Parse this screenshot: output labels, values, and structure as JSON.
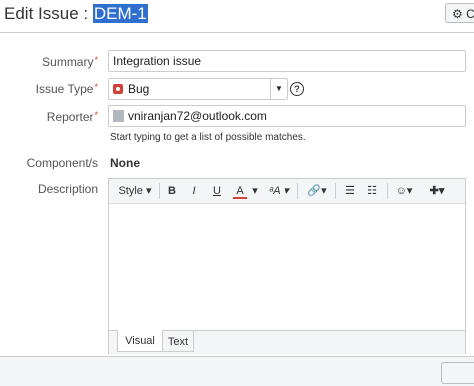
{
  "dialog": {
    "title_prefix": "Edit Issue : ",
    "issue_key": "DEM-1",
    "configure_label": "C"
  },
  "form": {
    "summary": {
      "label": "Summary",
      "value": "Integration issue"
    },
    "issue_type": {
      "label": "Issue Type",
      "value": "Bug"
    },
    "reporter": {
      "label": "Reporter",
      "value": "vniranjan72@outlook.com",
      "hint": "Start typing to get a list of possible matches."
    },
    "components": {
      "label": "Component/s",
      "value": "None"
    },
    "description": {
      "label": "Description"
    }
  },
  "editor": {
    "toolbar": {
      "style": "Style",
      "bold": "B",
      "italic": "I",
      "underline": "U",
      "text_color": "A",
      "more_format": "ᵃA"
    },
    "tabs": [
      "Visual",
      "Text"
    ]
  },
  "colors": {
    "selection": "#2f6fd0",
    "required": "#d04437",
    "bug": "#d04437"
  }
}
